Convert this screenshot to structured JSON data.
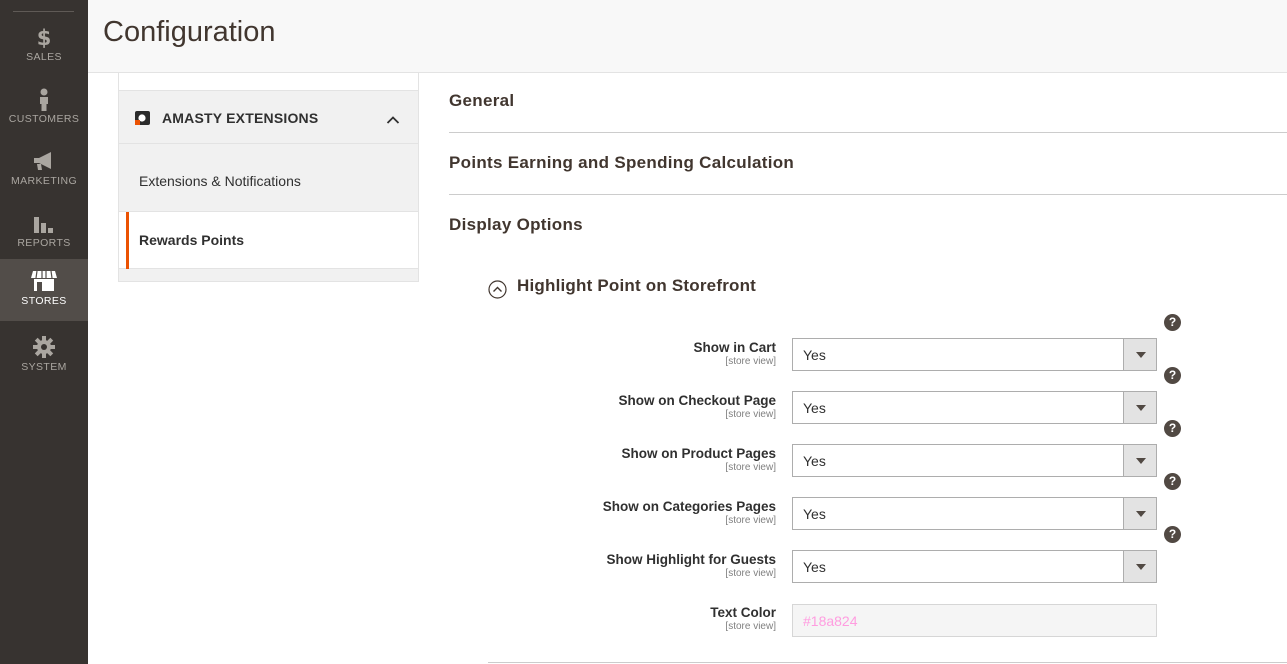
{
  "page": {
    "title": "Configuration"
  },
  "nav": {
    "items": [
      {
        "label": "SALES",
        "icon": "dollar-icon"
      },
      {
        "label": "CUSTOMERS",
        "icon": "person-icon"
      },
      {
        "label": "MARKETING",
        "icon": "megaphone-icon"
      },
      {
        "label": "REPORTS",
        "icon": "bar-chart-icon"
      },
      {
        "label": "STORES",
        "icon": "storefront-icon",
        "active": true
      },
      {
        "label": "SYSTEM",
        "icon": "gear-icon"
      }
    ]
  },
  "tabs": {
    "group_title": "AMASTY EXTENSIONS",
    "items": [
      {
        "label": "Extensions & Notifications"
      },
      {
        "label": "Rewards Points",
        "active": true
      }
    ]
  },
  "sections": [
    {
      "title": "General"
    },
    {
      "title": "Points Earning and Spending Calculation"
    },
    {
      "title": "Display Options"
    }
  ],
  "subsection": {
    "title": "Highlight Point on Storefront"
  },
  "fields": [
    {
      "label": "Show in Cart",
      "scope": "[store view]",
      "value": "Yes"
    },
    {
      "label": "Show on Checkout Page",
      "scope": "[store view]",
      "value": "Yes"
    },
    {
      "label": "Show on Product Pages",
      "scope": "[store view]",
      "value": "Yes"
    },
    {
      "label": "Show on Categories Pages",
      "scope": "[store view]",
      "value": "Yes"
    },
    {
      "label": "Show Highlight for Guests",
      "scope": "[store view]",
      "value": "Yes"
    }
  ],
  "text_color": {
    "label": "Text Color",
    "scope": "[store view]",
    "placeholder": "#18a824"
  },
  "help_glyph": "?",
  "colors": {
    "nav_bg": "#373330",
    "accent": "#eb5202",
    "placeholder": "#ff9de0"
  }
}
